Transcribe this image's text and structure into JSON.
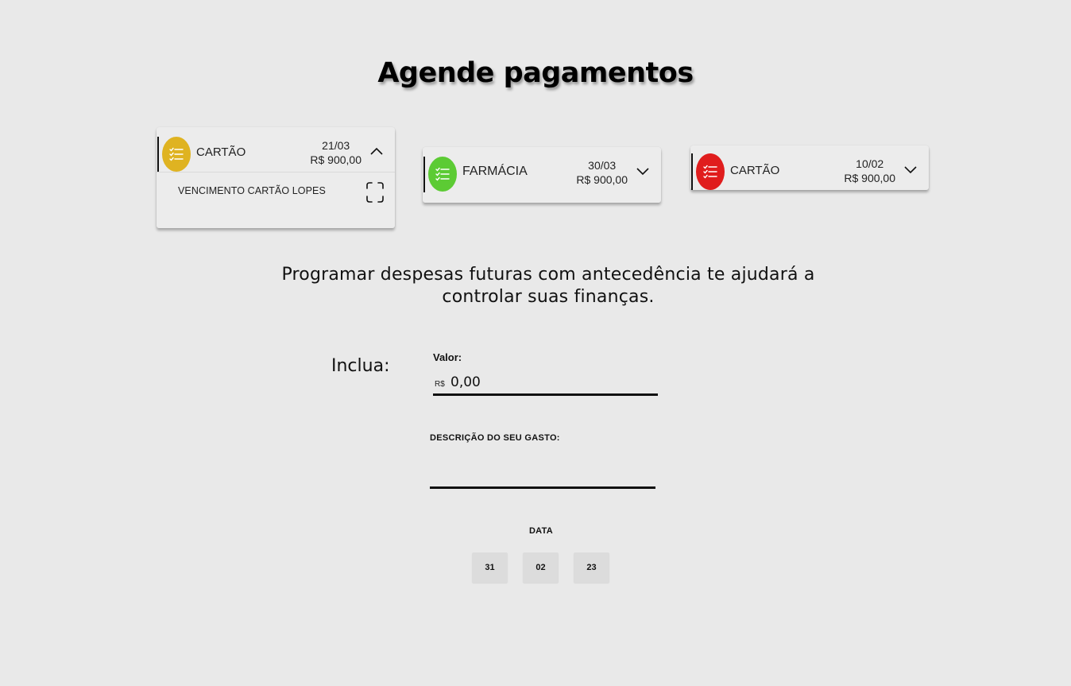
{
  "page": {
    "title": "Agende pagamentos"
  },
  "cards": [
    {
      "label": "CARTÃO",
      "date": "21/03",
      "amount": "R$ 900,00",
      "icon_color": "#dfb321",
      "expanded": true,
      "description": "VENCIMENTO CARTÃO LOPES"
    },
    {
      "label": "FARMÁCIA",
      "date": "30/03",
      "amount": "R$ 900,00",
      "icon_color": "#5ccb34",
      "expanded": false
    },
    {
      "label": "CARTÃO",
      "date": "10/02",
      "amount": "R$ 900,00",
      "icon_color": "#e01d1d",
      "expanded": false
    }
  ],
  "info_text": "Programar despesas futuras com antecedência te ajudará a controlar suas finanças.",
  "form": {
    "inclua_label": "Inclua:",
    "valor_label": "Valor:",
    "currency_prefix": "R$",
    "valor_value": "0,00",
    "descricao_label": "DESCRIÇÃO DO SEU GASTO:",
    "descricao_value": "",
    "data_label": "DATA",
    "date": {
      "day": "31",
      "month": "02",
      "year": "23"
    }
  },
  "icons": {
    "card_icon": "checklist-icon",
    "collapse": "chevron-up-icon",
    "expand": "chevron-down-icon",
    "scan": "scan-icon"
  }
}
